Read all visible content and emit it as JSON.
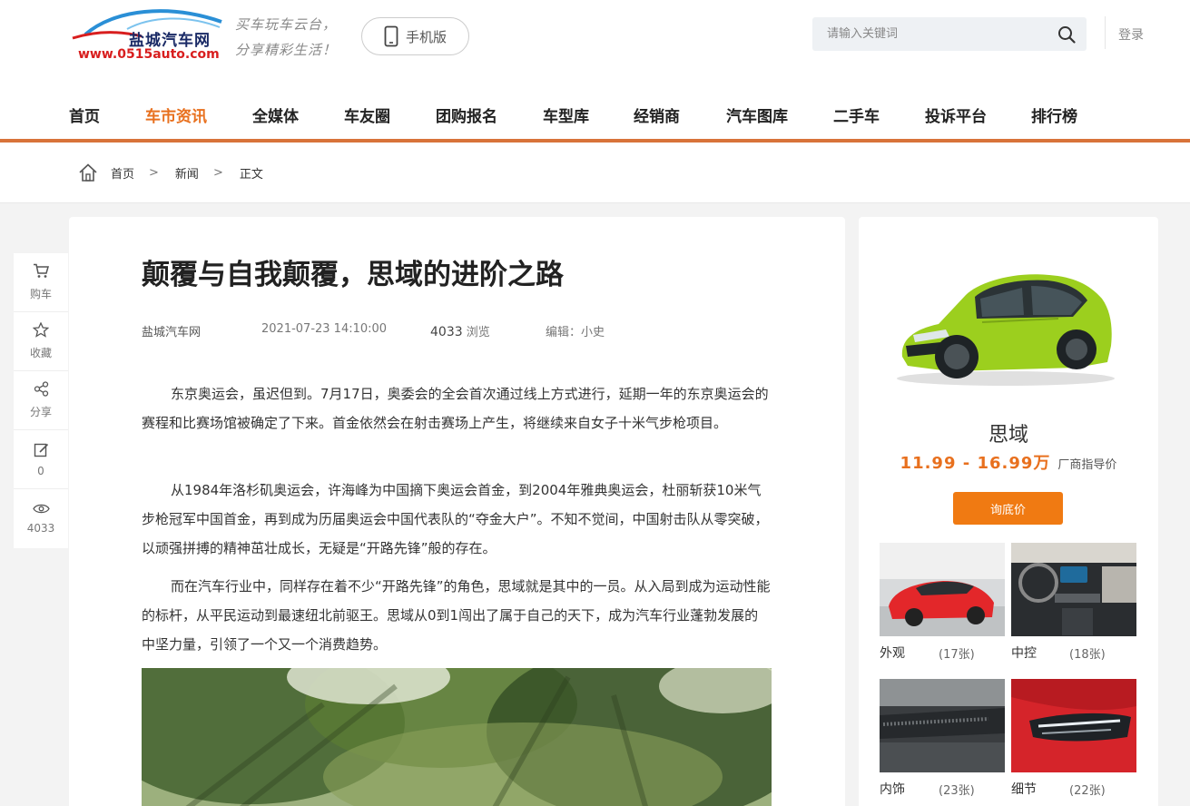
{
  "header": {
    "logo_text": "盐城汽车网",
    "logo_url": "www.0515auto.com",
    "slogan_line1": "买车玩车云台，",
    "slogan_line2": "分享精彩生活！",
    "mobile_label": "手机版",
    "search_placeholder": "请输入关键词",
    "login_label": "登录"
  },
  "nav": {
    "items": [
      {
        "label": "首页"
      },
      {
        "label": "车市资讯",
        "active": true
      },
      {
        "label": "全媒体"
      },
      {
        "label": "车友圈"
      },
      {
        "label": "团购报名"
      },
      {
        "label": "车型库"
      },
      {
        "label": "经销商"
      },
      {
        "label": "汽车图库"
      },
      {
        "label": "二手车"
      },
      {
        "label": "投诉平台"
      },
      {
        "label": "排行榜"
      }
    ]
  },
  "breadcrumb": {
    "home": "首页",
    "sep1": ">",
    "news": "新闻",
    "sep2": ">",
    "current": "正文"
  },
  "float_bar": {
    "buy": "购车",
    "fav": "收藏",
    "share": "分享",
    "comments": "0",
    "views": "4033"
  },
  "article": {
    "title": "颠覆与自我颠覆，思域的进阶之路",
    "source": "盐城汽车网",
    "date": "2021-07-23 14:10:00",
    "views_num": "4033",
    "views_unit": "浏览",
    "editor": "编辑：小史",
    "paragraphs": [
      "东京奥运会，虽迟但到。7月17日，奥委会的全会首次通过线上方式进行，延期一年的东京奥运会的赛程和比赛场馆被确定了下来。首金依然会在射击赛场上产生，将继续来自女子十米气步枪项目。",
      "从1984年洛杉矶奥运会，许海峰为中国摘下奥运会首金，到2004年雅典奥运会，杜丽斩获10米气步枪冠军中国首金，再到成为历届奥运会中国代表队的“夺金大户”。不知不觉间，中国射击队从零突破，以顽强拼搏的精神茁壮成长，无疑是“开路先锋”般的存在。",
      "而在汽车行业中，同样存在着不少“开路先锋”的角色，思域就是其中的一员。从入局到成为运动性能的标杆，从平民运动到最速纽北前驱王。思域从0到1闯出了属于自己的天下，成为汽车行业蓬勃发展的中坚力量，引领了一个又一个消费趋势。"
    ]
  },
  "sidebar": {
    "car_name": "思域",
    "price": "11.99 - 16.99万",
    "price_note": "厂商指导价",
    "ask_label": "询底价",
    "galleries": [
      {
        "label": "外观",
        "count": "(17张)"
      },
      {
        "label": "中控",
        "count": "(18张)"
      },
      {
        "label": "内饰",
        "count": "(23张)"
      },
      {
        "label": "细节",
        "count": "(22张)"
      }
    ]
  },
  "colors": {
    "accent": "#e8701e",
    "nav_line": "#d8733a",
    "button": "#f07a12",
    "car_body": "#9ccf1e"
  }
}
